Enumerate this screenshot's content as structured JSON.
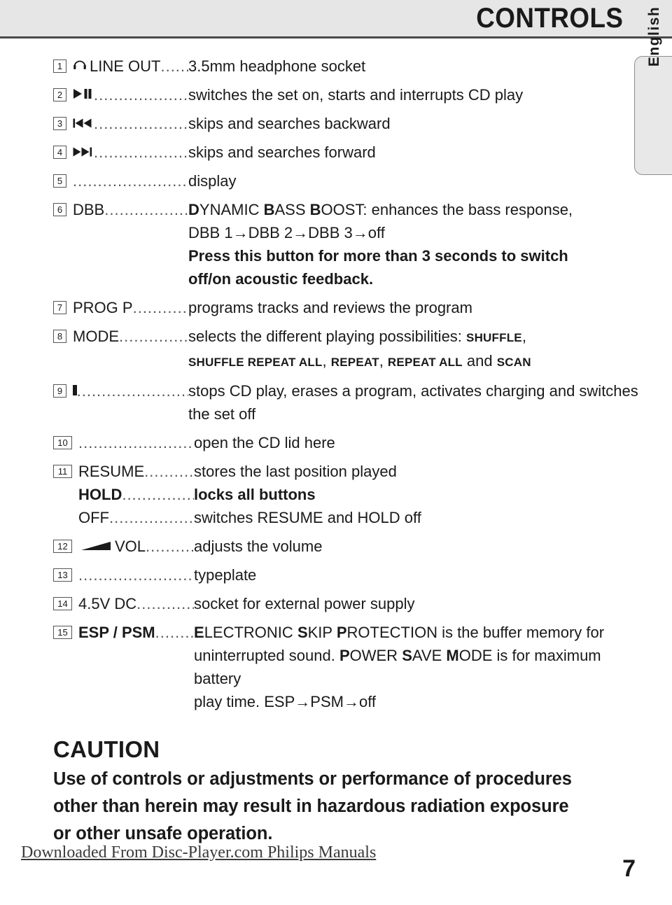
{
  "header": {
    "title": "CONTROLS"
  },
  "lang_tab": {
    "label": "English"
  },
  "controls": [
    {
      "num": "1",
      "icon": "headphone-icon",
      "label": "LINE OUT",
      "leader": "...",
      "desc": "3.5mm headphone socket"
    },
    {
      "num": "2",
      "icon": "play-pause-icon",
      "label": "",
      "leader": "................",
      "desc": "switches the set on, starts and interrupts CD play"
    },
    {
      "num": "3",
      "icon": "skip-backward-icon",
      "label": "",
      "leader": ".................",
      "desc": "skips and searches backward"
    },
    {
      "num": "4",
      "icon": "skip-forward-icon",
      "label": "",
      "leader": ".................",
      "desc": "skips and searches forward"
    },
    {
      "num": "5",
      "icon": "",
      "label": "",
      "leader": ".....................",
      "desc": "display"
    },
    {
      "num": "6",
      "icon": "",
      "label": "DBB",
      "leader": "...............",
      "desc_parts": [
        {
          "text": "D",
          "bold": true
        },
        {
          "text": "YNAMIC ",
          "bold": false
        },
        {
          "text": "B",
          "bold": true
        },
        {
          "text": "ASS ",
          "bold": false
        },
        {
          "text": "B",
          "bold": true
        },
        {
          "text": "OOST: enhances the bass response,",
          "bold": false
        }
      ],
      "cont_lines": [
        {
          "text": "DBB 1→DBB 2→DBB 3→off",
          "bold": false
        },
        {
          "text": "Press this button for more than 3 seconds to switch",
          "bold": true
        },
        {
          "text": "off/on acoustic feedback.",
          "bold": true
        }
      ]
    },
    {
      "num": "7",
      "icon": "",
      "label": "PROG P",
      "leader": ".........",
      "desc": "programs tracks and reviews the program"
    },
    {
      "num": "8",
      "icon": "",
      "label": "MODE",
      "leader": "...........",
      "desc_parts": [
        {
          "text": "selects the different playing possibilities: ",
          "bold": false
        },
        {
          "text": "SHUFFLE",
          "smallcap": true
        },
        {
          "text": ",",
          "bold": false
        }
      ],
      "cont_parts": [
        {
          "text": "SHUFFLE REPEAT ALL",
          "smallcap": true
        },
        {
          "text": ", ",
          "bold": false
        },
        {
          "text": "REPEAT",
          "smallcap": true
        },
        {
          "text": ", ",
          "bold": false
        },
        {
          "text": "REPEAT ALL",
          "smallcap": true
        },
        {
          "text": " and ",
          "bold": false
        },
        {
          "text": "SCAN",
          "smallcap": true
        }
      ]
    },
    {
      "num": "9",
      "icon": "stop-icon",
      "label": "",
      "leader": ".................",
      "desc": "stops CD play, erases a program, activates charging and switches",
      "cont_lines": [
        {
          "text": "the set off",
          "bold": false
        }
      ]
    },
    {
      "num": "10",
      "icon": "",
      "label": "",
      "leader": "....................",
      "desc": "open the CD lid here"
    },
    {
      "num": "11",
      "icon": "",
      "label": "RESUME",
      "leader": ".......",
      "desc": "stores the last position played",
      "sub_rows": [
        {
          "label": "HOLD",
          "label_bold": true,
          "leader": "..........",
          "desc": "locks all buttons",
          "desc_bold": true
        },
        {
          "label": "OFF",
          "label_bold": false,
          "leader": "..............",
          "desc": "switches RESUME and HOLD off",
          "desc_bold": false
        }
      ]
    },
    {
      "num": "12",
      "icon": "volume-icon",
      "label": "VOL",
      "leader": ".......",
      "desc": "adjusts the volume"
    },
    {
      "num": "13",
      "icon": "",
      "label": "",
      "leader": "....................",
      "desc": "typeplate"
    },
    {
      "num": "14",
      "icon": "",
      "label": "4.5V DC",
      "leader": ".........",
      "desc": "socket for external power supply"
    },
    {
      "num": "15",
      "icon": "",
      "label": "ESP / PSM",
      "label_bold": true,
      "leader": "...",
      "desc_parts": [
        {
          "text": "E",
          "bold": true
        },
        {
          "text": "LECTRONIC ",
          "bold": false
        },
        {
          "text": "S",
          "bold": true
        },
        {
          "text": "KIP ",
          "bold": false
        },
        {
          "text": "P",
          "bold": true
        },
        {
          "text": "ROTECTION is the buffer memory for",
          "bold": false
        }
      ],
      "cont_parts_lines": [
        [
          {
            "text": "uninterrupted sound. ",
            "bold": false
          },
          {
            "text": "P",
            "bold": true
          },
          {
            "text": "OWER ",
            "bold": false
          },
          {
            "text": "S",
            "bold": true
          },
          {
            "text": "AVE ",
            "bold": false
          },
          {
            "text": "M",
            "bold": true
          },
          {
            "text": "ODE is for maximum battery",
            "bold": false
          }
        ],
        [
          {
            "text": "play time. ESP→PSM→off",
            "bold": false
          }
        ]
      ]
    }
  ],
  "caution": {
    "title": "CAUTION",
    "lines": [
      "Use of controls or adjustments or performance of procedures",
      "other than herein may result in hazardous radiation exposure",
      "or other unsafe operation."
    ]
  },
  "footer": {
    "watermark": "Downloaded From Disc-Player.com Philips Manuals",
    "page_number": "7"
  }
}
